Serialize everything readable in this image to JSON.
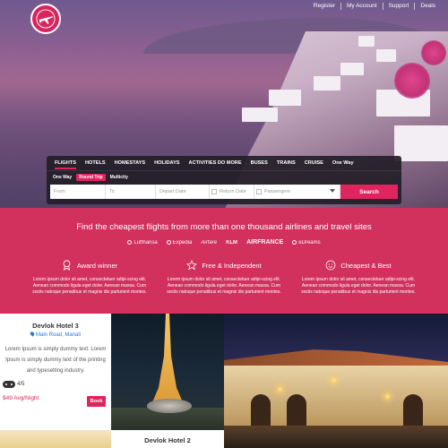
{
  "top_nav": {
    "links": [
      "Register",
      "My Account",
      "Support",
      "Deals"
    ]
  },
  "search": {
    "tabs": [
      "FLIGHTS",
      "HOTELS",
      "HOMESTAYS",
      "HOLIDAYS",
      "ACTIVITIES DO MORE",
      "BUSES",
      "TRAINS",
      "CRUISE",
      "One Way"
    ],
    "active_tab": "FLIGHTS",
    "trip_types": [
      "One Way",
      "Round Trip",
      "Multicity"
    ],
    "active_trip_type": "Round Trip",
    "fields": {
      "from_placeholder": "From",
      "to_placeholder": "To",
      "depart_placeholder": "Depart Date",
      "return_placeholder": "Return Date",
      "passengers_placeholder": "Passengers"
    },
    "button_label": "Search"
  },
  "band": {
    "headline": "Find the cheapest flights from more than one thousand airlines and travel sites",
    "partners": [
      "Lufthansa",
      "Expedia",
      "Airfare",
      "KLM",
      "AIRFRANCE",
      "eDreams"
    ],
    "features": [
      {
        "icon": "award-icon",
        "title": "Award winner",
        "text": "Lorem ipsum dolor sit amet, consectetuer adipi-scing elit. Aenean commodo ligula eget dolor. Aenean massa. Cum sociis natoque penatibus et magnis dis parturient montes."
      },
      {
        "icon": "star-icon",
        "title": "Free & Independent",
        "text": "Lorem ipsum dolor sit amet, consectetuer adipi-scing elit. Aenean commodo ligula eget dolor. Aenean massa. Cum sociis natoque penatibus et magnis dis parturient montes."
      },
      {
        "icon": "smile-icon",
        "title": "Cheapest & Best",
        "text": "Lorem ipsum dolor sit amet, consectetuer adipi-scing elit. Aenean commodo ligula eget dolor. Aenean massa. Cum sociis natoque penatibus et magnis dis parturient montes."
      }
    ]
  },
  "hotels": [
    {
      "name": "Devlok Hotel 3",
      "location": "Main Road, Manali",
      "description": "Lorem Ipsum is simply dummy text. Lorem Ipsum is simply dummy text of the printing and typesetting industry.",
      "rating": "4/5",
      "price": "$49 Avg/Night",
      "book_label": "Book"
    },
    {
      "name": "Devlok Hotel 2"
    }
  ],
  "colors": {
    "accent": "#e0245e",
    "band": "#d1315c",
    "link": "#2a7ad8"
  }
}
